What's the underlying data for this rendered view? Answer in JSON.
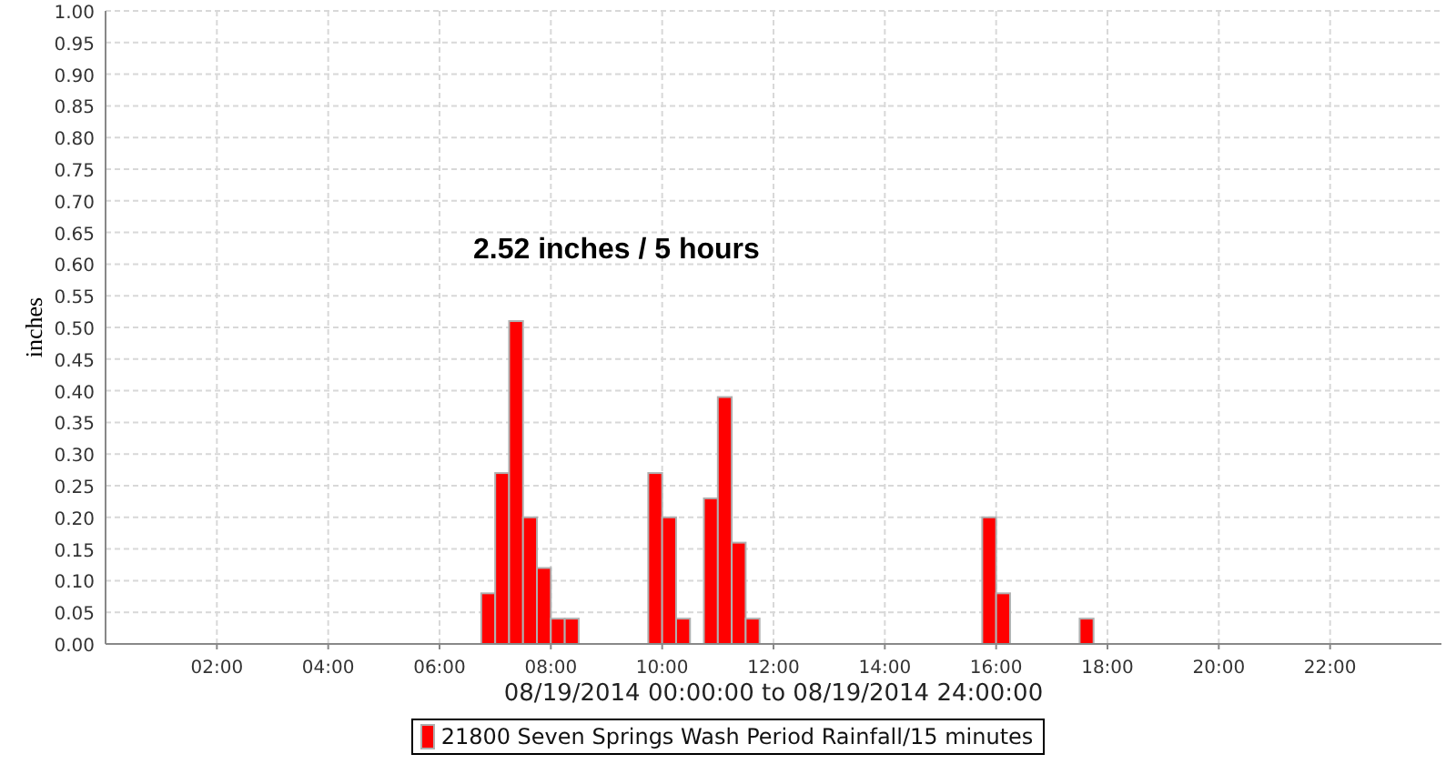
{
  "chart_data": {
    "type": "bar",
    "xlabel": "08/19/2014 00:00:00 to 08/19/2014 24:00:00",
    "ylabel": "inches",
    "x": [
      6.75,
      7,
      7.25,
      7.5,
      7.75,
      8,
      8.25,
      9.75,
      10,
      10.25,
      10.75,
      11,
      11.25,
      11.5,
      15.75,
      16,
      17.5
    ],
    "series": [
      {
        "name": "21800 Seven Springs Wash Period Rainfall/15 minutes",
        "color": "#ff0000",
        "values": [
          0.08,
          0.27,
          0.51,
          0.2,
          0.12,
          0.04,
          0.04,
          0.27,
          0.2,
          0.04,
          0.23,
          0.39,
          0.16,
          0.04,
          0.2,
          0.08,
          0.04
        ]
      }
    ],
    "xlim": [
      0,
      24
    ],
    "ylim": [
      0,
      1
    ],
    "xticks": [
      {
        "value": 2,
        "label": "02:00"
      },
      {
        "value": 4,
        "label": "04:00"
      },
      {
        "value": 6,
        "label": "06:00"
      },
      {
        "value": 8,
        "label": "08:00"
      },
      {
        "value": 10,
        "label": "10:00"
      },
      {
        "value": 12,
        "label": "12:00"
      },
      {
        "value": 14,
        "label": "14:00"
      },
      {
        "value": 16,
        "label": "16:00"
      },
      {
        "value": 18,
        "label": "18:00"
      },
      {
        "value": 20,
        "label": "20:00"
      },
      {
        "value": 22,
        "label": "22:00"
      }
    ],
    "yticks": [
      {
        "value": 0,
        "label": "0.00"
      },
      {
        "value": 0.05,
        "label": "0.05"
      },
      {
        "value": 0.1,
        "label": "0.10"
      },
      {
        "value": 0.15,
        "label": "0.15"
      },
      {
        "value": 0.2,
        "label": "0.20"
      },
      {
        "value": 0.25,
        "label": "0.25"
      },
      {
        "value": 0.3,
        "label": "0.30"
      },
      {
        "value": 0.35,
        "label": "0.35"
      },
      {
        "value": 0.4,
        "label": "0.40"
      },
      {
        "value": 0.45,
        "label": "0.45"
      },
      {
        "value": 0.5,
        "label": "0.50"
      },
      {
        "value": 0.55,
        "label": "0.55"
      },
      {
        "value": 0.6,
        "label": "0.60"
      },
      {
        "value": 0.65,
        "label": "0.65"
      },
      {
        "value": 0.7,
        "label": "0.70"
      },
      {
        "value": 0.75,
        "label": "0.75"
      },
      {
        "value": 0.8,
        "label": "0.80"
      },
      {
        "value": 0.85,
        "label": "0.85"
      },
      {
        "value": 0.9,
        "label": "0.90"
      },
      {
        "value": 0.95,
        "label": "0.95"
      },
      {
        "value": 1,
        "label": "1.00"
      }
    ],
    "grid": true,
    "annotations": [
      "2.52 inches / 5 hours"
    ]
  }
}
